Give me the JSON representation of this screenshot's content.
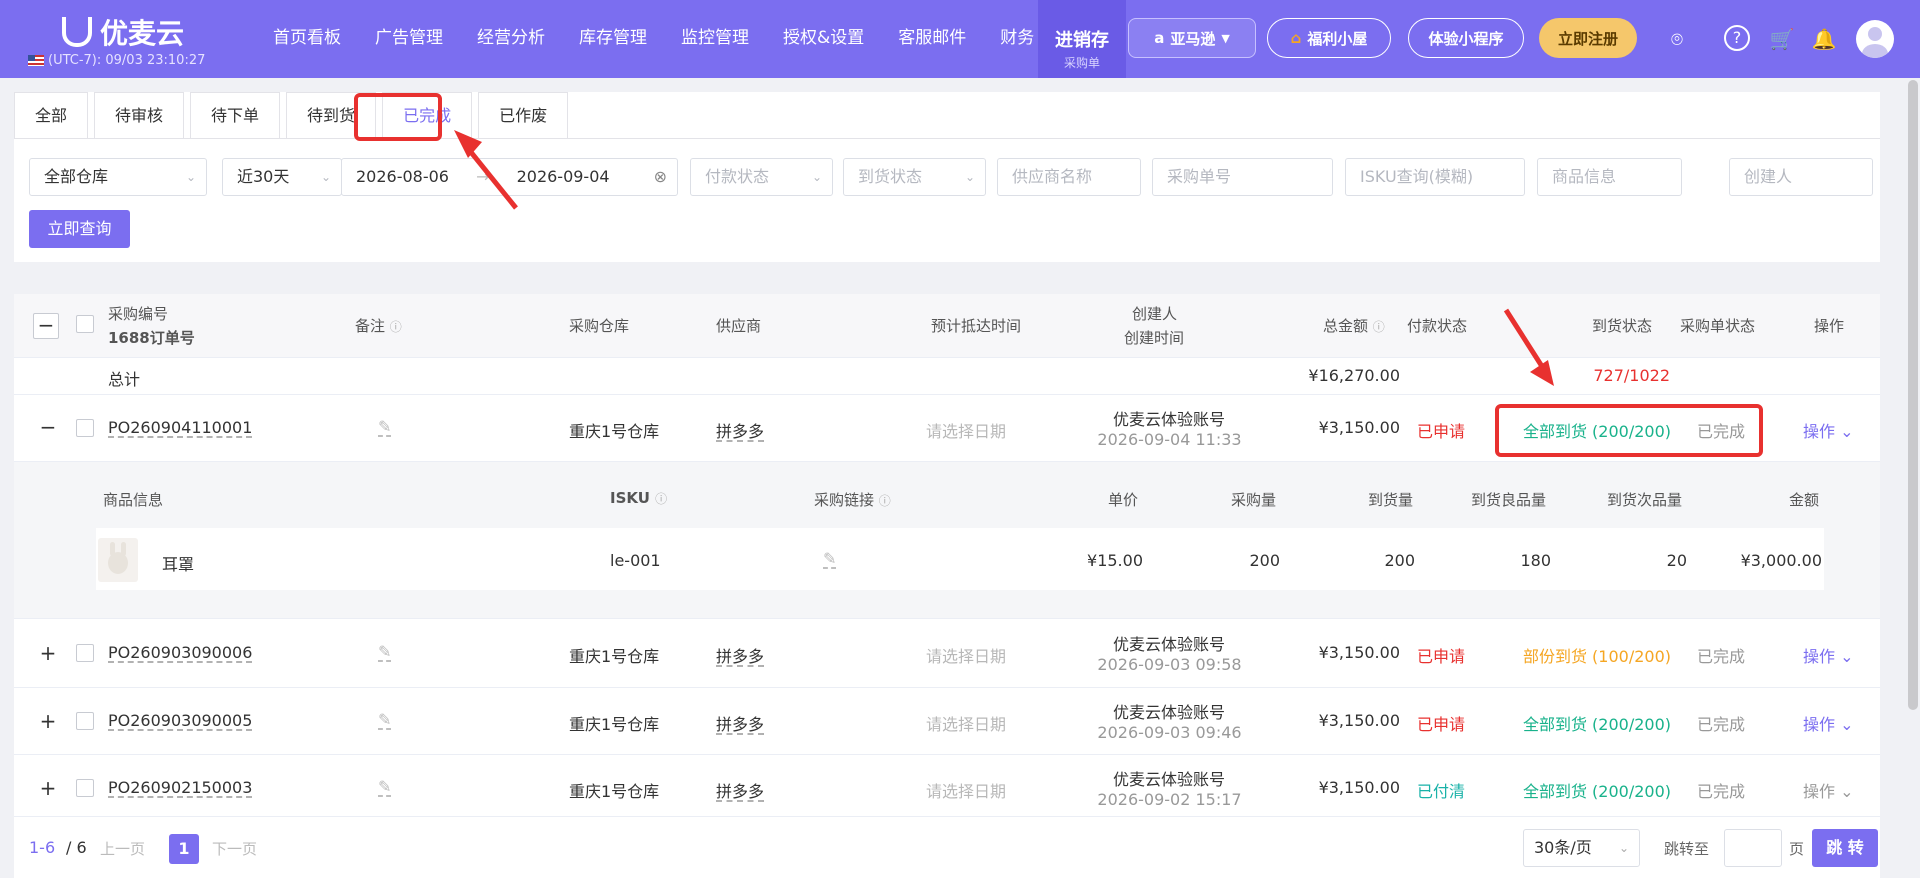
{
  "header": {
    "brand": "优麦云",
    "timezone": "(UTC-7): 09/03 23:10:27",
    "nav": [
      "首页看板",
      "广告管理",
      "经营分析",
      "库存管理",
      "监控管理",
      "授权&设置",
      "客服邮件",
      "财务"
    ],
    "nav_active": {
      "label": "进销存",
      "sub": "采购单"
    },
    "marketplace": "亚马逊",
    "welfare": "福利小屋",
    "mini_program": "体验小程序",
    "register": "立即注册"
  },
  "tabs": [
    "全部",
    "待审核",
    "待下单",
    "待到货",
    "已完成",
    "已作废"
  ],
  "filters": {
    "warehouse": "全部仓库",
    "range": "近30天",
    "start_date": "2026-08-06",
    "end_date": "2026-09-04",
    "payment_status": "付款状态",
    "arrival_status": "到货状态",
    "supplier": "供应商名称",
    "po_no": "采购单号",
    "isku": "ISKU查询(模糊)",
    "product": "商品信息",
    "creator": "创建人",
    "query_button": "立即查询"
  },
  "table": {
    "headers": {
      "po": "采购编号",
      "po_sub": "1688订单号",
      "note": "备注",
      "warehouse": "采购仓库",
      "supplier": "供应商",
      "eta": "预计抵达时间",
      "creator": "创建人",
      "created": "创建时间",
      "total": "总金额",
      "pay": "付款状态",
      "arrival": "到货状态",
      "status": "采购单状态",
      "action": "操作"
    },
    "summary": {
      "label": "总计",
      "total": "¥16,270.00",
      "arrival": "727/1022"
    },
    "rows": [
      {
        "po": "PO260904110001",
        "warehouse": "重庆1号仓库",
        "supplier": "拼多多",
        "eta": "请选择日期",
        "creator": "优麦云体验账号",
        "created": "2026-09-04 11:33",
        "total": "¥3,150.00",
        "pay": "已申请",
        "arrival": "全部到货 (200/200)",
        "status": "已完成",
        "action": "操作",
        "expand": "−"
      },
      {
        "po": "PO260903090006",
        "warehouse": "重庆1号仓库",
        "supplier": "拼多多",
        "eta": "请选择日期",
        "creator": "优麦云体验账号",
        "created": "2026-09-03 09:58",
        "total": "¥3,150.00",
        "pay": "已申请",
        "arrival": "部份到货 (100/200)",
        "status": "已完成",
        "action": "操作",
        "expand": "+"
      },
      {
        "po": "PO260903090005",
        "warehouse": "重庆1号仓库",
        "supplier": "拼多多",
        "eta": "请选择日期",
        "creator": "优麦云体验账号",
        "created": "2026-09-03 09:46",
        "total": "¥3,150.00",
        "pay": "已申请",
        "arrival": "全部到货 (200/200)",
        "status": "已完成",
        "action": "操作",
        "expand": "+"
      },
      {
        "po": "PO260902150003",
        "warehouse": "重庆1号仓库",
        "supplier": "拼多多",
        "eta": "请选择日期",
        "creator": "优麦云体验账号",
        "created": "2026-09-02 15:17",
        "total": "¥3,150.00",
        "pay": "已付清",
        "arrival": "全部到货 (200/200)",
        "status": "已完成",
        "action": "操作",
        "expand": "+"
      }
    ],
    "sub": {
      "headers": {
        "product": "商品信息",
        "isku": "ISKU",
        "link": "采购链接",
        "price": "单价",
        "qty": "采购量",
        "arrived": "到货量",
        "good": "到货良品量",
        "defect": "到货次品量",
        "amount": "金额"
      },
      "item": {
        "product": "耳罩",
        "isku": "le-001",
        "price": "¥15.00",
        "qty": "200",
        "arrived": "200",
        "good": "180",
        "defect": "20",
        "amount": "¥3,000.00"
      }
    }
  },
  "pagination": {
    "range": "1-6",
    "total": "/ 6",
    "prev": "上一页",
    "page": "1",
    "next": "下一页",
    "per_page": "30条/页",
    "jump_to": "跳转至",
    "page_unit": "页",
    "jump": "跳 转"
  }
}
